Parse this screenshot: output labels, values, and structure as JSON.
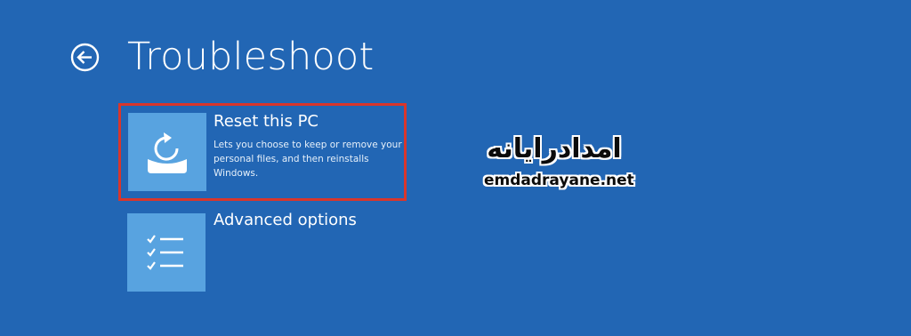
{
  "header": {
    "back_icon": "back-arrow-circle-icon",
    "title": "Troubleshoot"
  },
  "options": [
    {
      "title": "Reset this PC",
      "description": "Lets you choose to keep or remove your personal files, and then reinstalls Windows.",
      "icon": "reset-pc-icon",
      "selected": true
    },
    {
      "title": "Advanced options",
      "description": "",
      "icon": "checklist-icon",
      "selected": false
    }
  ],
  "watermark": {
    "name_fa": "امدادرایانه",
    "url": "emdadrayane.net"
  },
  "colors": {
    "background": "#2266b4",
    "tile": "#58a3e0",
    "highlight_border": "#d9362b",
    "text": "#ffffff"
  }
}
